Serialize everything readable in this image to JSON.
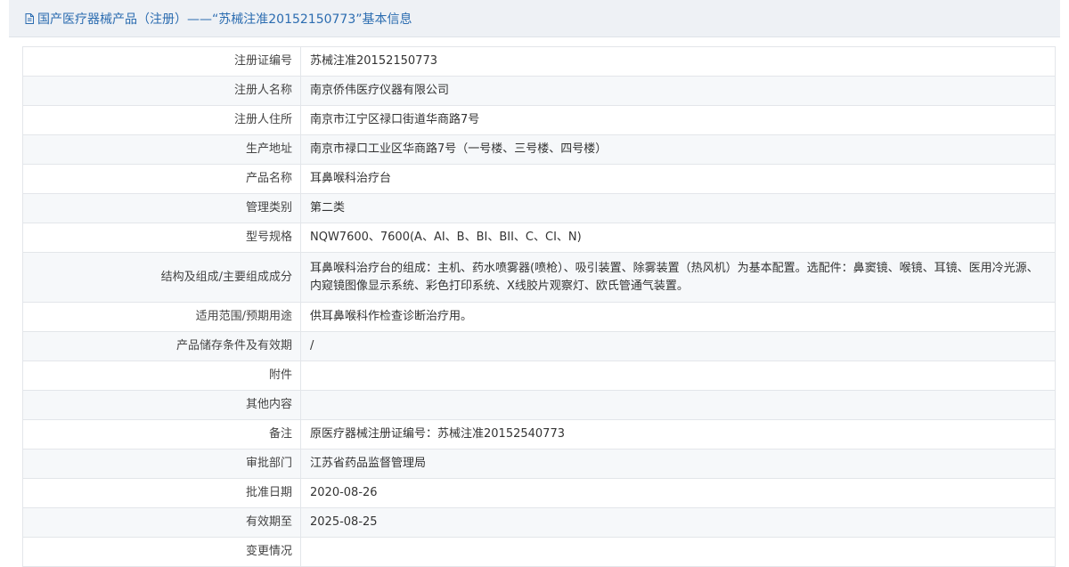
{
  "header": {
    "title": "国产医疗器械产品（注册）——“苏械注准20152150773”基本信息",
    "icon": "document-icon"
  },
  "rows": [
    {
      "label": "注册证编号",
      "value": "苏械注准20152150773"
    },
    {
      "label": "注册人名称",
      "value": "南京侨伟医疗仪器有限公司"
    },
    {
      "label": "注册人住所",
      "value": "南京市江宁区禄口街道华商路7号"
    },
    {
      "label": "生产地址",
      "value": "南京市禄口工业区华商路7号（一号楼、三号楼、四号楼）"
    },
    {
      "label": "产品名称",
      "value": "耳鼻喉科治疗台"
    },
    {
      "label": "管理类别",
      "value": "第二类"
    },
    {
      "label": "型号规格",
      "value": "NQW7600、7600(A、AI、B、BI、BII、C、CI、N)"
    },
    {
      "label": "结构及组成/主要组成成分",
      "value": "耳鼻喉科治疗台的组成：主机、药水喷雾器(喷枪）、吸引装置、除雾装置（热风机）为基本配置。选配件：鼻窦镜、喉镜、耳镜、医用冷光源、内窥镜图像显示系统、彩色打印系统、X线胶片观察灯、欧氏管通气装置。"
    },
    {
      "label": "适用范围/预期用途",
      "value": "供耳鼻喉科作检查诊断治疗用。"
    },
    {
      "label": "产品储存条件及有效期",
      "value": "/"
    },
    {
      "label": "附件",
      "value": ""
    },
    {
      "label": "其他内容",
      "value": ""
    },
    {
      "label": "备注",
      "value": "原医疗器械注册证编号：苏械注准20152540773"
    },
    {
      "label": "审批部门",
      "value": "江苏省药品监督管理局"
    },
    {
      "label": "批准日期",
      "value": "2020-08-26"
    },
    {
      "label": "有效期至",
      "value": "2025-08-25"
    },
    {
      "label": "变更情况",
      "value": ""
    }
  ]
}
